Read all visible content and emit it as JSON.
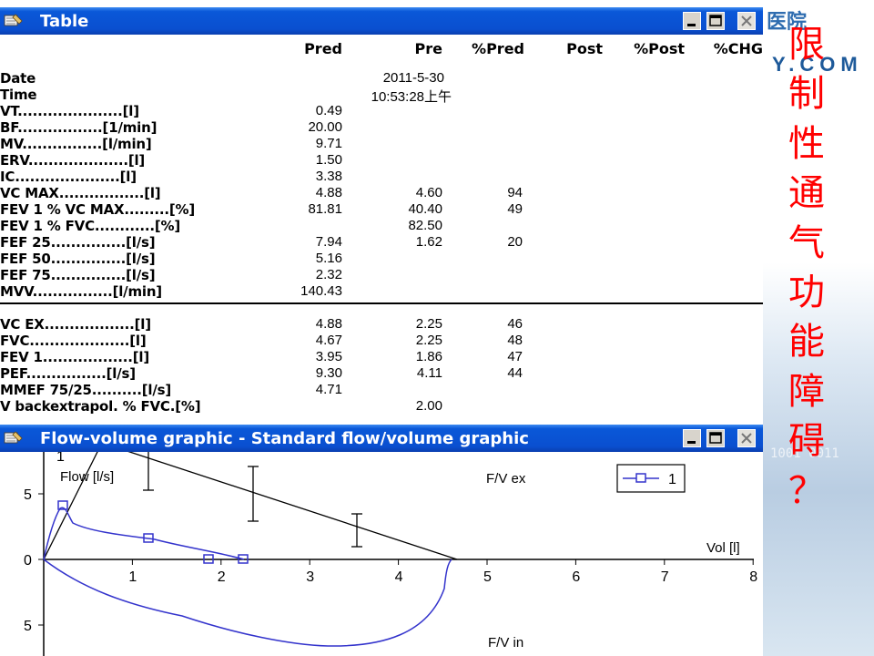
{
  "table_window": {
    "title": "Table",
    "columns": [
      "Pred",
      "Pre",
      "%Pred",
      "Post",
      "%Post",
      "%CHG"
    ],
    "date_label": "Date",
    "date_value": "2011-5-30",
    "time_label": "Time",
    "time_value": "10:53:28上午",
    "rows_top": [
      {
        "label": "VT.....................[l]",
        "pred": "0.49",
        "pre": "",
        "pct": ""
      },
      {
        "label": "BF.................[1/min]",
        "pred": "20.00",
        "pre": "",
        "pct": ""
      },
      {
        "label": "MV................[l/min]",
        "pred": "9.71",
        "pre": "",
        "pct": ""
      },
      {
        "label": "ERV....................[l]",
        "pred": "1.50",
        "pre": "",
        "pct": ""
      },
      {
        "label": "IC.....................[l]",
        "pred": "3.38",
        "pre": "",
        "pct": ""
      },
      {
        "label": "VC MAX.................[l]",
        "pred": "4.88",
        "pre": "4.60",
        "pct": "94"
      },
      {
        "label": "FEV 1 % VC MAX.........[%]",
        "pred": "81.81",
        "pre": "40.40",
        "pct": "49"
      },
      {
        "label": "FEV 1 % FVC............[%]",
        "pred": "",
        "pre": "82.50",
        "pct": ""
      },
      {
        "label": "FEF 25...............[l/s]",
        "pred": "7.94",
        "pre": "1.62",
        "pct": "20"
      },
      {
        "label": "FEF 50...............[l/s]",
        "pred": "5.16",
        "pre": "",
        "pct": ""
      },
      {
        "label": "FEF 75...............[l/s]",
        "pred": "2.32",
        "pre": "",
        "pct": ""
      },
      {
        "label": "MVV................[l/min]",
        "pred": "140.43",
        "pre": "",
        "pct": ""
      }
    ],
    "rows_bottom": [
      {
        "label": "VC EX..................[l]",
        "pred": "4.88",
        "pre": "2.25",
        "pct": "46"
      },
      {
        "label": "FVC....................[l]",
        "pred": "4.67",
        "pre": "2.25",
        "pct": "48"
      },
      {
        "label": "FEV 1..................[l]",
        "pred": "3.95",
        "pre": "1.86",
        "pct": "47"
      },
      {
        "label": "PEF................[l/s]",
        "pred": "9.30",
        "pre": "4.11",
        "pct": "44"
      },
      {
        "label": "MMEF 75/25..........[l/s]",
        "pred": "4.71",
        "pre": "",
        "pct": ""
      },
      {
        "label": "V backextrapol. % FVC.[%]",
        "pred": "",
        "pre": "2.00",
        "pct": ""
      }
    ]
  },
  "graph_window": {
    "title": "Flow-volume graphic - Standard flow/volume graphic",
    "y_label": "Flow [l/s]",
    "x_label": "Vol [l]",
    "expiration_label": "F/V ex",
    "inspiration_label": "F/V in",
    "legend_entry": "1",
    "x_ticks": [
      "1",
      "2",
      "3",
      "4",
      "5",
      "6",
      "7",
      "8"
    ],
    "y_ticks": [
      "5",
      "0",
      "5"
    ],
    "curve_color": "#3333cc"
  },
  "window_buttons": {
    "minimize_icon": "minimize-icon",
    "maximize_icon": "maximize-icon",
    "close_icon": "close-icon"
  },
  "slide": {
    "caption_chars": [
      "限",
      "制",
      "性",
      "通",
      "气",
      "功",
      "能",
      "障",
      "碍",
      "？"
    ],
    "caption_color": "#ff0000",
    "brand_fragment": "Y.COM",
    "brand_fragment_top": "医院",
    "background_digits": "1001  0011"
  }
}
